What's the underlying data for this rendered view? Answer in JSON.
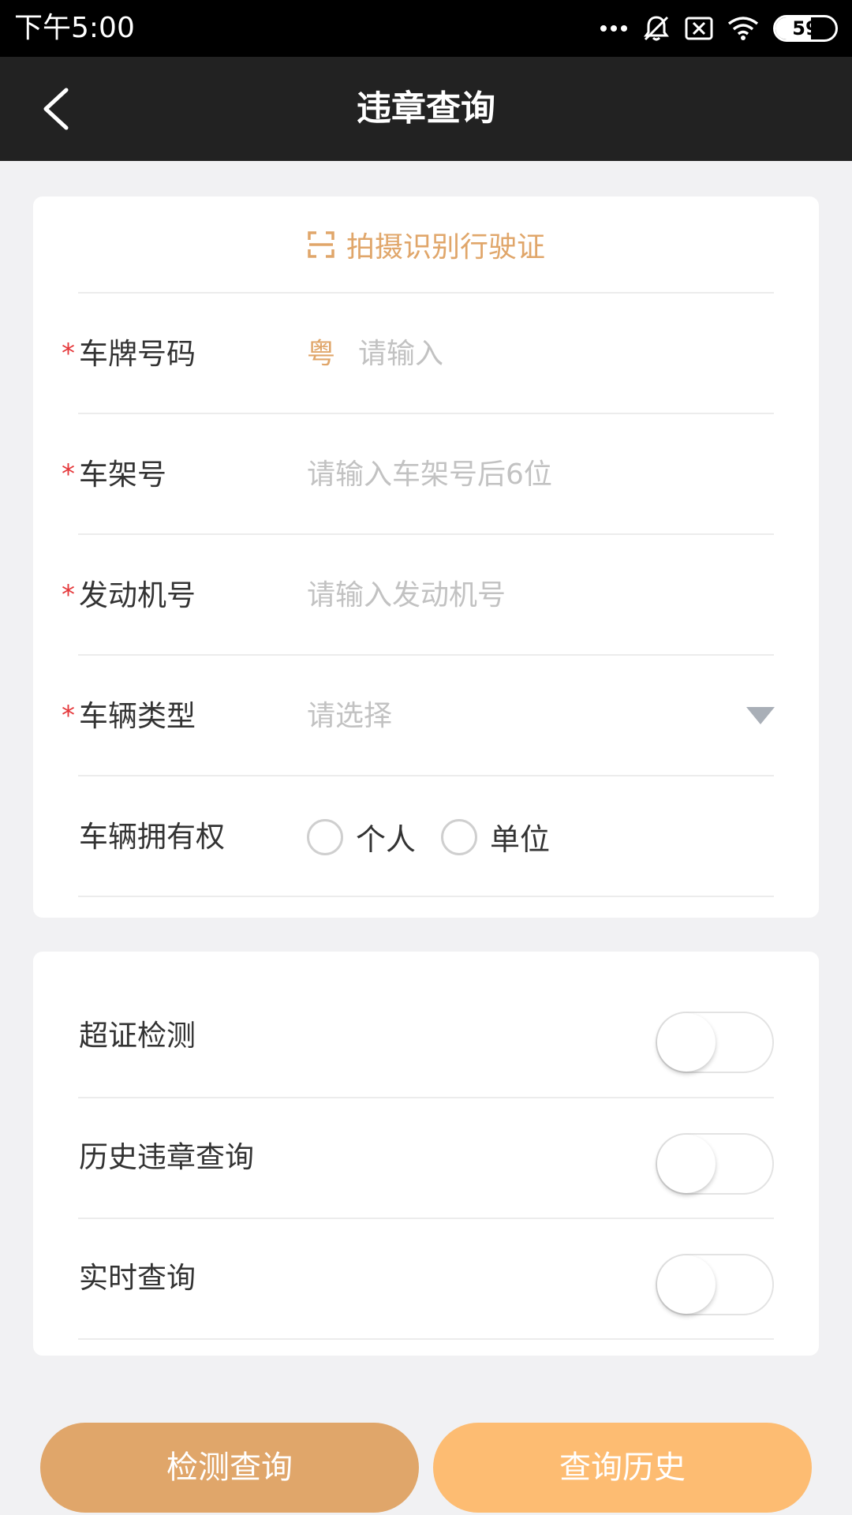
{
  "status_bar": {
    "time": "下午5:00",
    "battery_level": "59",
    "icons": [
      "more-dots-icon",
      "mute-bell-icon",
      "no-sim-icon",
      "wifi-icon",
      "battery-icon"
    ]
  },
  "app_bar": {
    "title": "违章查询",
    "back_icon": "back-arrow-icon"
  },
  "scan": {
    "label": "拍摄识别行驶证",
    "icon": "scan-icon"
  },
  "form": {
    "plate": {
      "label": "车牌号码",
      "required": "*",
      "prefix": "粤",
      "placeholder": "请输入"
    },
    "frame": {
      "label": "车架号",
      "required": "*",
      "placeholder": "请输入车架号后6位"
    },
    "engine": {
      "label": "发动机号",
      "required": "*",
      "placeholder": "请输入发动机号"
    },
    "vehicle_type": {
      "label": "车辆类型",
      "required": "*",
      "placeholder": "请选择"
    },
    "ownership": {
      "label": "车辆拥有权",
      "options": [
        "个人",
        "单位"
      ]
    }
  },
  "toggles": [
    {
      "label": "超证检测",
      "on": false
    },
    {
      "label": "历史违章查询",
      "on": false
    },
    {
      "label": "实时查询",
      "on": false
    }
  ],
  "buttons": {
    "check": "检测查询",
    "history": "查询历史"
  },
  "colors": {
    "accent": "#e0a66a",
    "accent_light": "#fdbc72",
    "required": "#e5383b",
    "app_bar": "#222222"
  }
}
